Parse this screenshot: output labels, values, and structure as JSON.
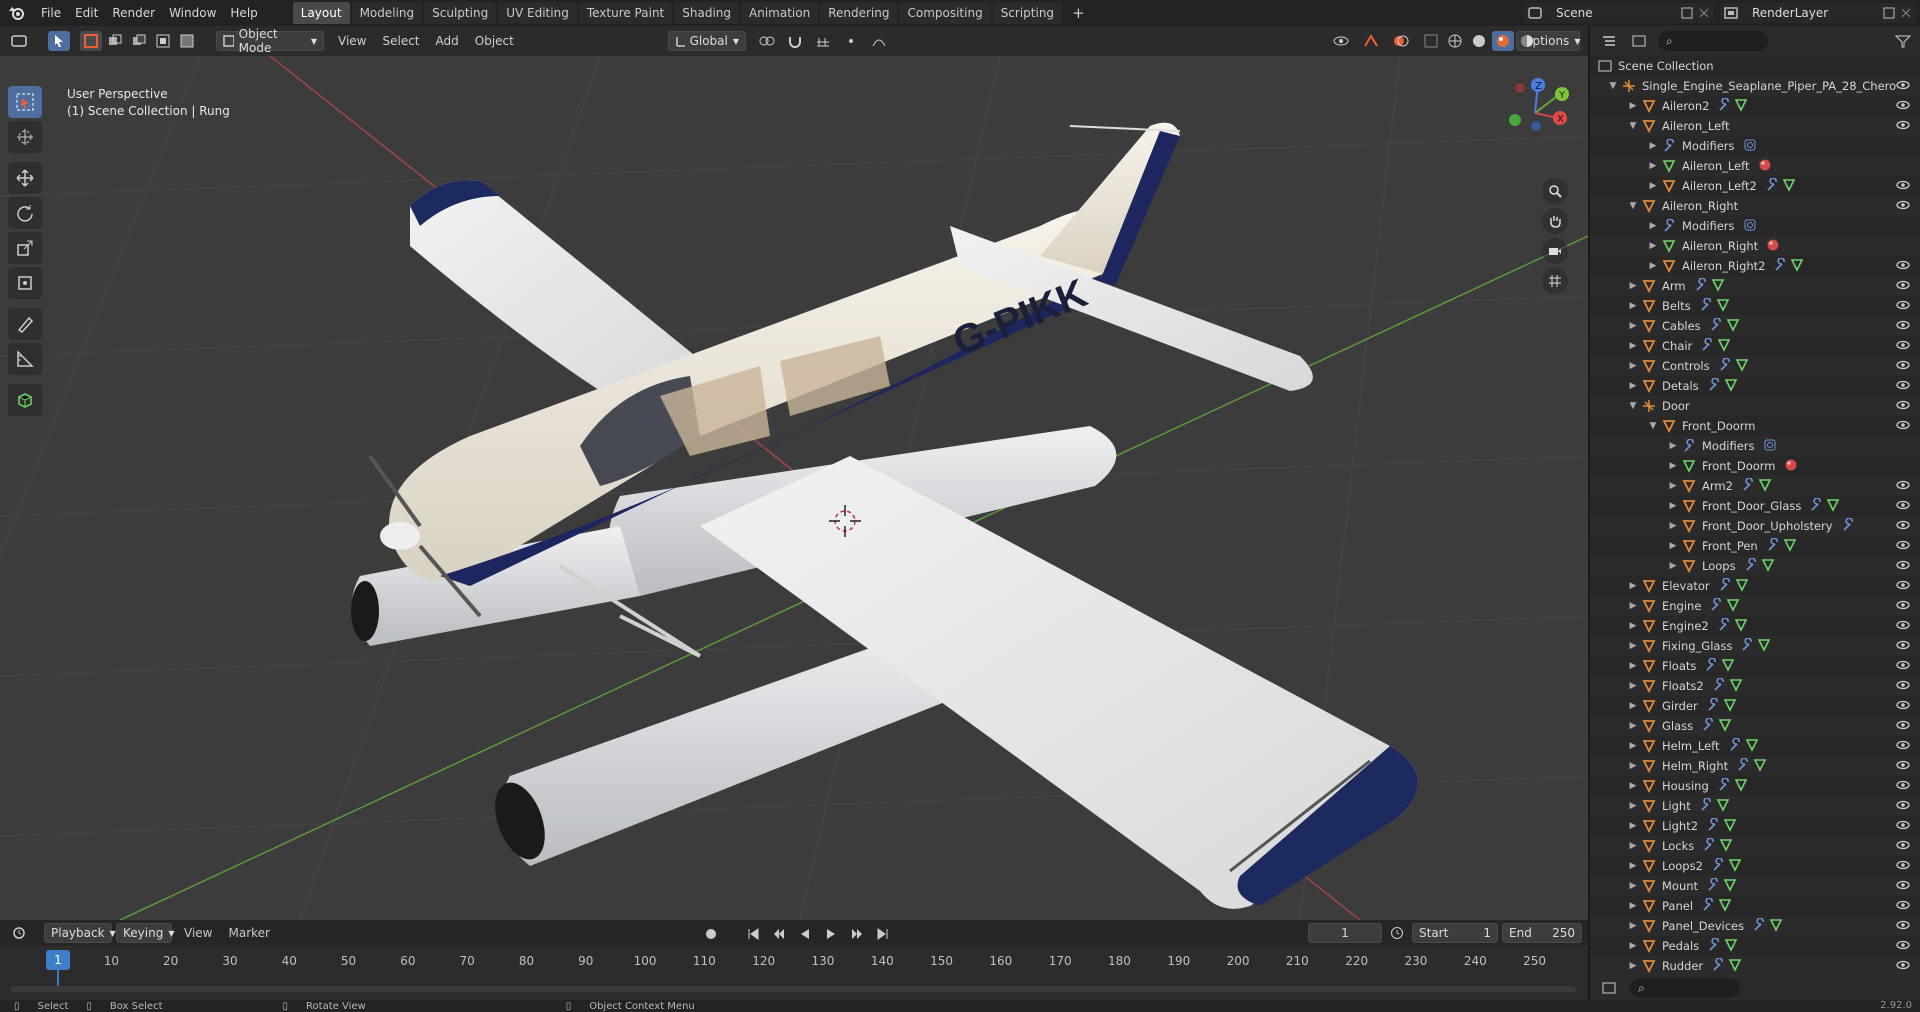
{
  "topbar": {
    "menus": [
      "File",
      "Edit",
      "Render",
      "Window",
      "Help"
    ],
    "workspaces": [
      "Layout",
      "Modeling",
      "Sculpting",
      "UV Editing",
      "Texture Paint",
      "Shading",
      "Animation",
      "Rendering",
      "Compositing",
      "Scripting"
    ],
    "active_workspace": "Layout",
    "scene": "Scene",
    "render_layer": "RenderLayer"
  },
  "header": {
    "mode": "Object Mode",
    "menus": [
      "View",
      "Select",
      "Add",
      "Object"
    ],
    "transform_orientation": "Global",
    "options": "Options"
  },
  "viewport": {
    "perspective": "User Perspective",
    "collection": "(1) Scene Collection | Rung",
    "registration": "G-PIKK",
    "gizmo": {
      "x": "X",
      "y": "Y",
      "z": "Z"
    }
  },
  "outliner": {
    "root": "Scene Collection",
    "items": [
      {
        "name": "Single_Engine_Seaplane_Piper_PA_28_Chero",
        "depth": 0,
        "exp": "open",
        "type": "empty",
        "mods": []
      },
      {
        "name": "Aileron2",
        "depth": 1,
        "exp": "closed",
        "type": "mesh",
        "mods": [
          "wrench",
          "tri"
        ]
      },
      {
        "name": "Aileron_Left",
        "depth": 1,
        "exp": "open",
        "type": "mesh",
        "mods": []
      },
      {
        "name": "Modifiers",
        "depth": 2,
        "exp": "closed",
        "type": "wrench",
        "mods": [
          "circle"
        ]
      },
      {
        "name": "Aileron_Left",
        "depth": 2,
        "exp": "closed",
        "type": "tri",
        "mods": [
          "mat"
        ]
      },
      {
        "name": "Aileron_Left2",
        "depth": 2,
        "exp": "closed",
        "type": "mesh",
        "mods": [
          "wrench",
          "tri"
        ]
      },
      {
        "name": "Aileron_Right",
        "depth": 1,
        "exp": "open",
        "type": "mesh",
        "mods": []
      },
      {
        "name": "Modifiers",
        "depth": 2,
        "exp": "closed",
        "type": "wrench",
        "mods": [
          "circle"
        ]
      },
      {
        "name": "Aileron_Right",
        "depth": 2,
        "exp": "closed",
        "type": "tri",
        "mods": [
          "mat"
        ]
      },
      {
        "name": "Aileron_Right2",
        "depth": 2,
        "exp": "closed",
        "type": "mesh",
        "mods": [
          "wrench",
          "tri"
        ]
      },
      {
        "name": "Arm",
        "depth": 1,
        "exp": "closed",
        "type": "mesh",
        "mods": [
          "wrench",
          "tri"
        ]
      },
      {
        "name": "Belts",
        "depth": 1,
        "exp": "closed",
        "type": "mesh",
        "mods": [
          "wrench",
          "tri"
        ]
      },
      {
        "name": "Cables",
        "depth": 1,
        "exp": "closed",
        "type": "mesh",
        "mods": [
          "wrench",
          "tri"
        ]
      },
      {
        "name": "Chair",
        "depth": 1,
        "exp": "closed",
        "type": "mesh",
        "mods": [
          "wrench",
          "tri"
        ]
      },
      {
        "name": "Controls",
        "depth": 1,
        "exp": "closed",
        "type": "mesh",
        "mods": [
          "wrench",
          "tri"
        ]
      },
      {
        "name": "Detals",
        "depth": 1,
        "exp": "closed",
        "type": "mesh",
        "mods": [
          "wrench",
          "tri"
        ]
      },
      {
        "name": "Door",
        "depth": 1,
        "exp": "open",
        "type": "empty",
        "mods": []
      },
      {
        "name": "Front_Doorm",
        "depth": 2,
        "exp": "open",
        "type": "mesh",
        "mods": []
      },
      {
        "name": "Modifiers",
        "depth": 3,
        "exp": "closed",
        "type": "wrench",
        "mods": [
          "circle"
        ]
      },
      {
        "name": "Front_Doorm",
        "depth": 3,
        "exp": "closed",
        "type": "tri",
        "mods": [
          "mat"
        ]
      },
      {
        "name": "Arm2",
        "depth": 3,
        "exp": "closed",
        "type": "mesh",
        "mods": [
          "wrench",
          "tri"
        ]
      },
      {
        "name": "Front_Door_Glass",
        "depth": 3,
        "exp": "closed",
        "type": "mesh",
        "mods": [
          "wrench",
          "tri"
        ]
      },
      {
        "name": "Front_Door_Upholstery",
        "depth": 3,
        "exp": "closed",
        "type": "mesh",
        "mods": [
          "wrench"
        ]
      },
      {
        "name": "Front_Pen",
        "depth": 3,
        "exp": "closed",
        "type": "mesh",
        "mods": [
          "wrench",
          "tri"
        ]
      },
      {
        "name": "Loops",
        "depth": 3,
        "exp": "closed",
        "type": "mesh",
        "mods": [
          "wrench",
          "tri"
        ]
      },
      {
        "name": "Elevator",
        "depth": 1,
        "exp": "closed",
        "type": "mesh",
        "mods": [
          "wrench",
          "tri"
        ]
      },
      {
        "name": "Engine",
        "depth": 1,
        "exp": "closed",
        "type": "mesh",
        "mods": [
          "wrench",
          "tri"
        ]
      },
      {
        "name": "Engine2",
        "depth": 1,
        "exp": "closed",
        "type": "mesh",
        "mods": [
          "wrench",
          "tri"
        ]
      },
      {
        "name": "Fixing_Glass",
        "depth": 1,
        "exp": "closed",
        "type": "mesh",
        "mods": [
          "wrench",
          "tri"
        ]
      },
      {
        "name": "Floats",
        "depth": 1,
        "exp": "closed",
        "type": "mesh",
        "mods": [
          "wrench",
          "tri"
        ]
      },
      {
        "name": "Floats2",
        "depth": 1,
        "exp": "closed",
        "type": "mesh",
        "mods": [
          "wrench",
          "tri"
        ]
      },
      {
        "name": "Girder",
        "depth": 1,
        "exp": "closed",
        "type": "mesh",
        "mods": [
          "wrench",
          "tri"
        ]
      },
      {
        "name": "Glass",
        "depth": 1,
        "exp": "closed",
        "type": "mesh",
        "mods": [
          "wrench",
          "tri"
        ]
      },
      {
        "name": "Helm_Left",
        "depth": 1,
        "exp": "closed",
        "type": "mesh",
        "mods": [
          "wrench",
          "tri"
        ]
      },
      {
        "name": "Helm_Right",
        "depth": 1,
        "exp": "closed",
        "type": "mesh",
        "mods": [
          "wrench",
          "tri"
        ]
      },
      {
        "name": "Housing",
        "depth": 1,
        "exp": "closed",
        "type": "mesh",
        "mods": [
          "wrench",
          "tri"
        ]
      },
      {
        "name": "Light",
        "depth": 1,
        "exp": "closed",
        "type": "mesh",
        "mods": [
          "wrench",
          "tri"
        ]
      },
      {
        "name": "Light2",
        "depth": 1,
        "exp": "closed",
        "type": "mesh",
        "mods": [
          "wrench",
          "tri"
        ]
      },
      {
        "name": "Locks",
        "depth": 1,
        "exp": "closed",
        "type": "mesh",
        "mods": [
          "wrench",
          "tri"
        ]
      },
      {
        "name": "Loops2",
        "depth": 1,
        "exp": "closed",
        "type": "mesh",
        "mods": [
          "wrench",
          "tri"
        ]
      },
      {
        "name": "Mount",
        "depth": 1,
        "exp": "closed",
        "type": "mesh",
        "mods": [
          "wrench",
          "tri"
        ]
      },
      {
        "name": "Panel",
        "depth": 1,
        "exp": "closed",
        "type": "mesh",
        "mods": [
          "wrench",
          "tri"
        ]
      },
      {
        "name": "Panel_Devices",
        "depth": 1,
        "exp": "closed",
        "type": "mesh",
        "mods": [
          "wrench",
          "tri"
        ]
      },
      {
        "name": "Pedals",
        "depth": 1,
        "exp": "closed",
        "type": "mesh",
        "mods": [
          "wrench",
          "tri"
        ]
      },
      {
        "name": "Rudder",
        "depth": 1,
        "exp": "closed",
        "type": "mesh",
        "mods": [
          "wrench",
          "tri"
        ]
      }
    ]
  },
  "timeline": {
    "menus": [
      "Playback",
      "Keying",
      "View",
      "Marker"
    ],
    "current_frame": "1",
    "start_label": "Start",
    "start": "1",
    "end_label": "End",
    "end": "250",
    "ticks": [
      "10",
      "20",
      "30",
      "40",
      "50",
      "60",
      "70",
      "80",
      "90",
      "100",
      "110",
      "120",
      "130",
      "140",
      "150",
      "160",
      "170",
      "180",
      "190",
      "200",
      "210",
      "220",
      "230",
      "240",
      "250"
    ]
  },
  "statusbar": {
    "select": "Select",
    "box_select": "Box Select",
    "rotate": "Rotate View",
    "context": "Object Context Menu",
    "version": "2.92.0"
  },
  "colors": {
    "accent": "#4d6e9e",
    "mesh": "#e08a3c",
    "modifier": "#6f93d6",
    "tri": "#6fd66b",
    "frame": "#3d7ec7"
  }
}
